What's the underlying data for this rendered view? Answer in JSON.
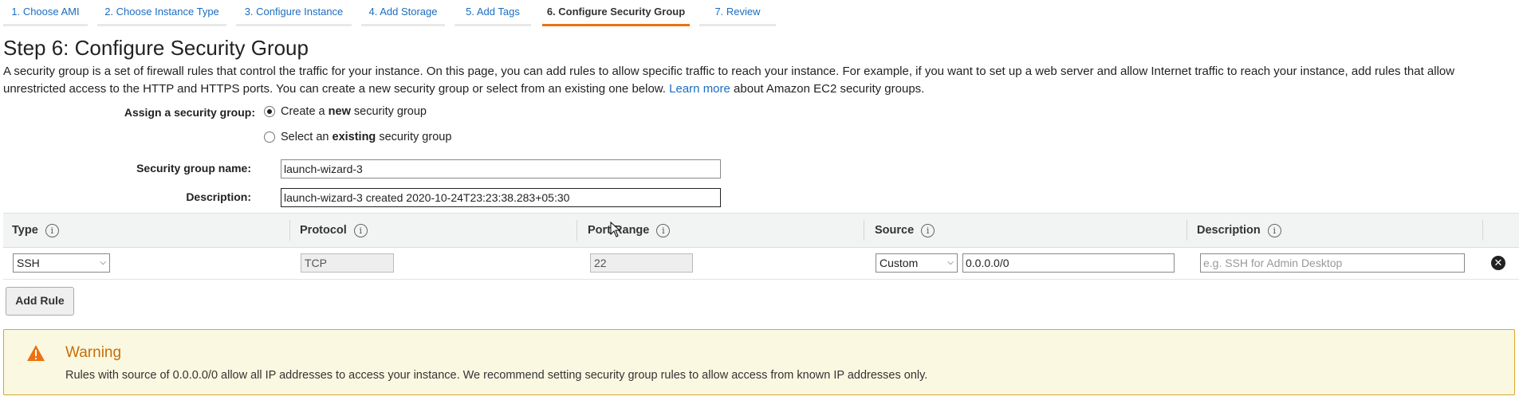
{
  "wizard": {
    "tabs": [
      {
        "label": "1. Choose AMI"
      },
      {
        "label": "2. Choose Instance Type"
      },
      {
        "label": "3. Configure Instance"
      },
      {
        "label": "4. Add Storage"
      },
      {
        "label": "5. Add Tags"
      },
      {
        "label": "6. Configure Security Group",
        "active": true
      },
      {
        "label": "7. Review"
      }
    ]
  },
  "page": {
    "title": "Step 6: Configure Security Group",
    "intro_before_link": "A security group is a set of firewall rules that control the traffic for your instance. On this page, you can add rules to allow specific traffic to reach your instance. For example, if you want to set up a web server and allow Internet traffic to reach your instance, add rules that allow unrestricted access to the HTTP and HTTPS ports. You can create a new security group or select from an existing one below.",
    "learn_more": "Learn more",
    "intro_after_link": "about Amazon EC2 security groups."
  },
  "form": {
    "assign_label": "Assign a security group:",
    "option_create_pre": "Create a ",
    "option_create_bold": "new",
    "option_create_post": " security group",
    "option_select_pre": "Select an ",
    "option_select_bold": "existing",
    "option_select_post": " security group",
    "selected_option": "create",
    "name_label": "Security group name:",
    "name_value": "launch-wizard-3",
    "description_label": "Description:",
    "description_value": "launch-wizard-3 created 2020-10-24T23:23:38.283+05:30"
  },
  "rules_table": {
    "headers": [
      "Type",
      "Protocol",
      "Port Range",
      "Source",
      "Description"
    ],
    "rows": [
      {
        "type": "SSH",
        "protocol": "TCP",
        "port_range": "22",
        "source_type": "Custom",
        "source_cidr": "0.0.0.0/0",
        "description_placeholder": "e.g. SSH for Admin Desktop"
      }
    ],
    "add_rule_label": "Add Rule"
  },
  "warning": {
    "title": "Warning",
    "message": "Rules with source of 0.0.0.0/0 allow all IP addresses to access your instance. We recommend setting security group rules to allow access from known IP addresses only."
  },
  "colors": {
    "link": "#1b6dc1",
    "active_tab_underline": "#ec7211",
    "warning_bg": "#fbf8e1",
    "warning_border": "#d5a72c",
    "warning_title": "#c56e09"
  },
  "icons": {
    "info": "info-icon",
    "remove": "close-circle-icon",
    "warning": "warning-triangle-icon",
    "dropdown": "chevron-down-icon"
  }
}
